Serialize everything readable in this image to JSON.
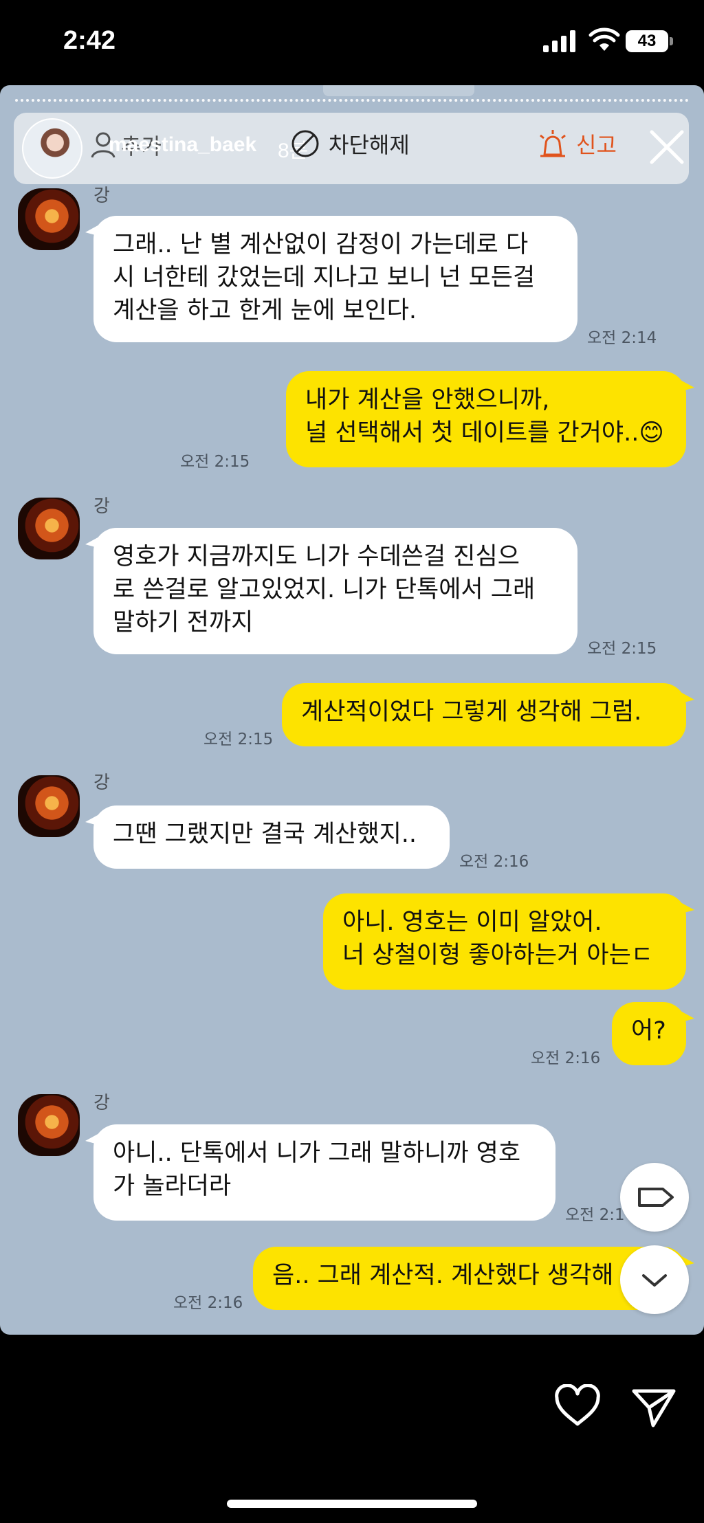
{
  "status_bar": {
    "time": "2:42",
    "battery": "43"
  },
  "story": {
    "username": "maestina_baek",
    "age": "8분",
    "add_friend_label": "추가",
    "unblock_label": "차단해제",
    "report_label": "신고"
  },
  "messages": [
    {
      "side": "in",
      "sender": "강",
      "text": "그래.. 난 별 계산없이 감정이 가는데로 다\n시 너한테 갔었는데 지나고 보니 넌 모든걸\n계산을 하고 한게 눈에 보인다.",
      "time": "오전 2:14"
    },
    {
      "side": "out",
      "text": "내가 계산을 안했으니까,\n널 선택해서 첫 데이트를 간거야..😊",
      "time": "오전 2:15"
    },
    {
      "side": "in",
      "sender": "강",
      "text": "영호가 지금까지도 니가 수데쓴걸 진심으\n로 쓴걸로 알고있었지. 니가 단톡에서 그래\n말하기 전까지",
      "time": "오전 2:15"
    },
    {
      "side": "out",
      "text": "계산적이었다 그렇게 생각해 그럼.",
      "time": "오전 2:15"
    },
    {
      "side": "in",
      "sender": "강",
      "text": "그땐 그랬지만 결국 계산했지..",
      "time": "오전 2:16"
    },
    {
      "side": "out",
      "text": "아니. 영호는 이미 알았어.\n너 상철이형 좋아하는거 아는ㄷ",
      "time": ""
    },
    {
      "side": "out",
      "text": "어?",
      "time": "오전 2:16"
    },
    {
      "side": "in",
      "sender": "강",
      "text": "아니.. 단톡에서 니가 그래 말하니까 영호\n가 놀라더라",
      "time": "오전 2:1"
    },
    {
      "side": "out",
      "text": "음.. 그래 계산적. 계산했다 생각해",
      "time": "오전 2:16"
    }
  ],
  "colors": {
    "chat_bg": "#aabbcd",
    "out_bubble": "#fde300",
    "in_bubble": "#ffffff",
    "report": "#e0531c"
  }
}
